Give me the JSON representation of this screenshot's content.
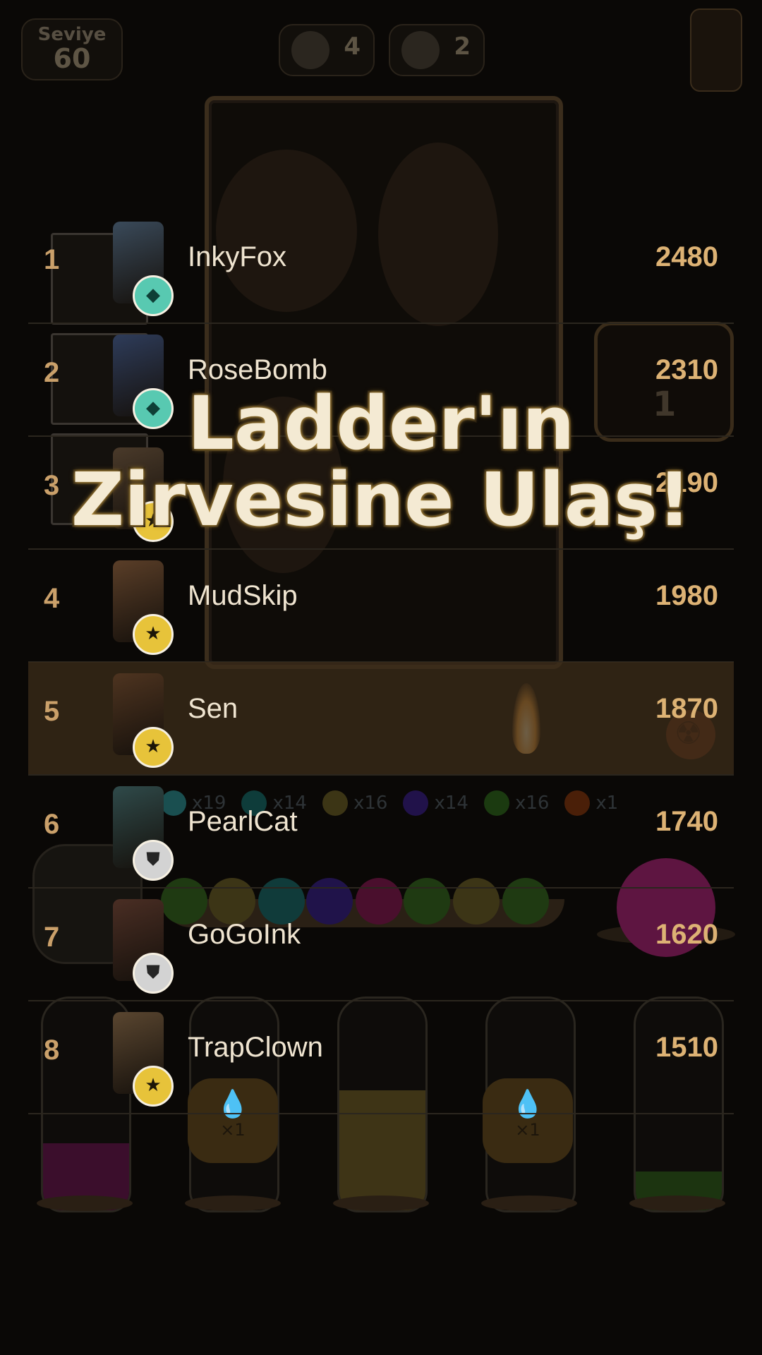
{
  "hud": {
    "level_label": "Seviye",
    "level_value": "60",
    "resource1_value": "4",
    "resource2_value": "2"
  },
  "side_card": {
    "value": "1"
  },
  "ball_counts": [
    {
      "color": "#1a4f50",
      "label": "x19"
    },
    {
      "color": "#0e3c3a",
      "label": "x14"
    },
    {
      "color": "#3c3515",
      "label": "x16"
    },
    {
      "color": "#21124a",
      "label": "x14"
    },
    {
      "color": "#1b3a10",
      "label": "x16"
    },
    {
      "color": "#4a1f08",
      "label": "x1"
    }
  ],
  "drop_badges": [
    "×1",
    "×1"
  ],
  "leaderboard": [
    {
      "rank": "1",
      "name": "InkyFox",
      "score": "2480",
      "badge": "teal",
      "badge_icon": "diamond-icon",
      "avatar_color": "#3a4a5a"
    },
    {
      "rank": "2",
      "name": "RoseBomb",
      "score": "2310",
      "badge": "teal",
      "badge_icon": "diamond-icon",
      "avatar_color": "#2e3c5a"
    },
    {
      "rank": "3",
      "name": "",
      "score": "2190",
      "badge": "gold",
      "badge_icon": "star-icon",
      "avatar_color": "#4a3a2a"
    },
    {
      "rank": "4",
      "name": "MudSkip",
      "score": "1980",
      "badge": "gold",
      "badge_icon": "star-icon",
      "avatar_color": "#5a3e28"
    },
    {
      "rank": "5",
      "name": "Sen",
      "score": "1870",
      "badge": "gold",
      "badge_icon": "star-icon",
      "avatar_color": "#4e3420",
      "highlight": true
    },
    {
      "rank": "6",
      "name": "PearlCat",
      "score": "1740",
      "badge": "silver",
      "badge_icon": "shield-icon",
      "avatar_color": "#2f4a4a"
    },
    {
      "rank": "7",
      "name": "GoGoInk",
      "score": "1620",
      "badge": "silver",
      "badge_icon": "shield-icon",
      "avatar_color": "#4a2e24"
    },
    {
      "rank": "8",
      "name": "TrapClown",
      "score": "1510",
      "badge": "gold",
      "badge_icon": "star-icon",
      "avatar_color": "#5a4630"
    }
  ],
  "banner": {
    "line1": "Ladder'ın",
    "line2": "Zirvesine Ulaş!"
  }
}
